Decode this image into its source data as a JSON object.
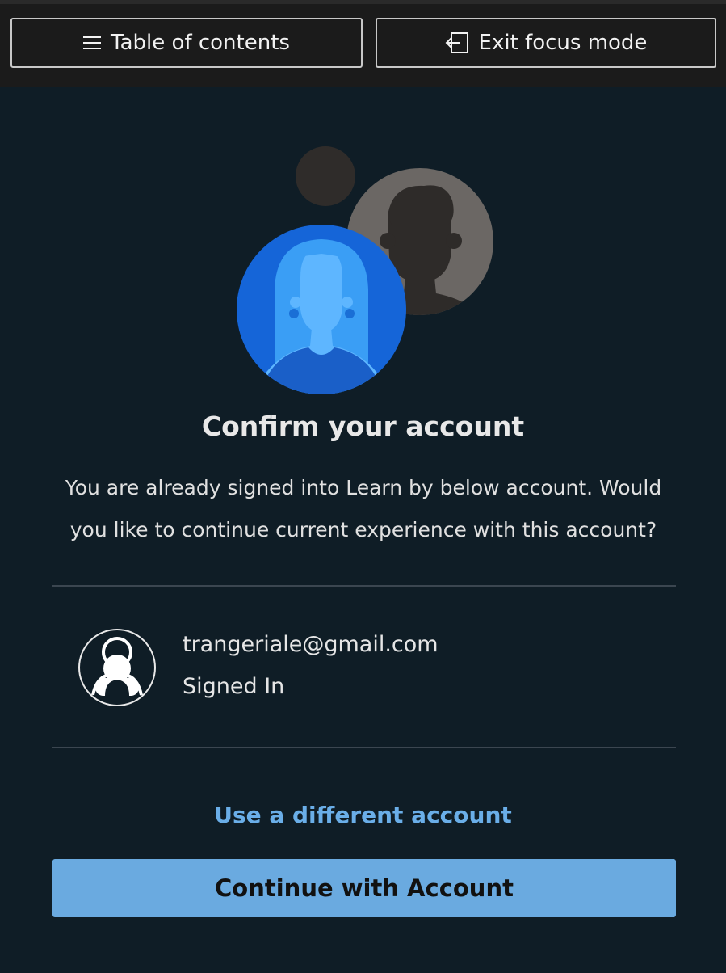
{
  "toolbar": {
    "toc_label": "Table of contents",
    "toc_icon": "hamburger-menu-icon",
    "exit_label": "Exit focus mode",
    "exit_icon": "exit-icon"
  },
  "dialog": {
    "title": "Confirm your account",
    "description": "You are already signed into Learn by below account. Would you like to continue current experience with this account?",
    "account": {
      "email": "trangeriale@gmail.com",
      "status": "Signed In",
      "avatar_icon": "user-avatar-icon"
    },
    "alternate_link": "Use a different account",
    "primary_button": "Continue with Account"
  },
  "colors": {
    "background": "#0f1d26",
    "toolbar_bg": "#1b1b1b",
    "link": "#6aaee8",
    "primary_button": "#6aaae0",
    "avatar_blue": "#1a6fd6"
  }
}
